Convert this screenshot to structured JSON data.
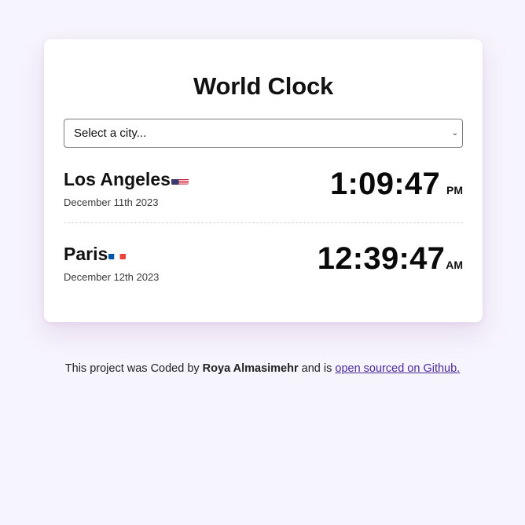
{
  "app": {
    "title": "World Clock"
  },
  "city_select": {
    "placeholder_label": "Select a city..."
  },
  "cities": [
    {
      "name": "Los Angeles",
      "flag_icon": "us-flag-icon",
      "date": "December 11th 2023",
      "time": "1:09:47",
      "period": "PM"
    },
    {
      "name": "Paris",
      "flag_icon": "france-flag-icon",
      "date": "December 12th 2023",
      "time": "12:39:47",
      "period": "AM"
    }
  ],
  "footer": {
    "prefix": "This project was Coded by ",
    "author": "Roya Almasimehr",
    "middle": " and is ",
    "link_label": "open sourced on Github."
  },
  "colors": {
    "background": "#f6f4fc",
    "card": "#ffffff",
    "link": "#4b2a9b"
  }
}
